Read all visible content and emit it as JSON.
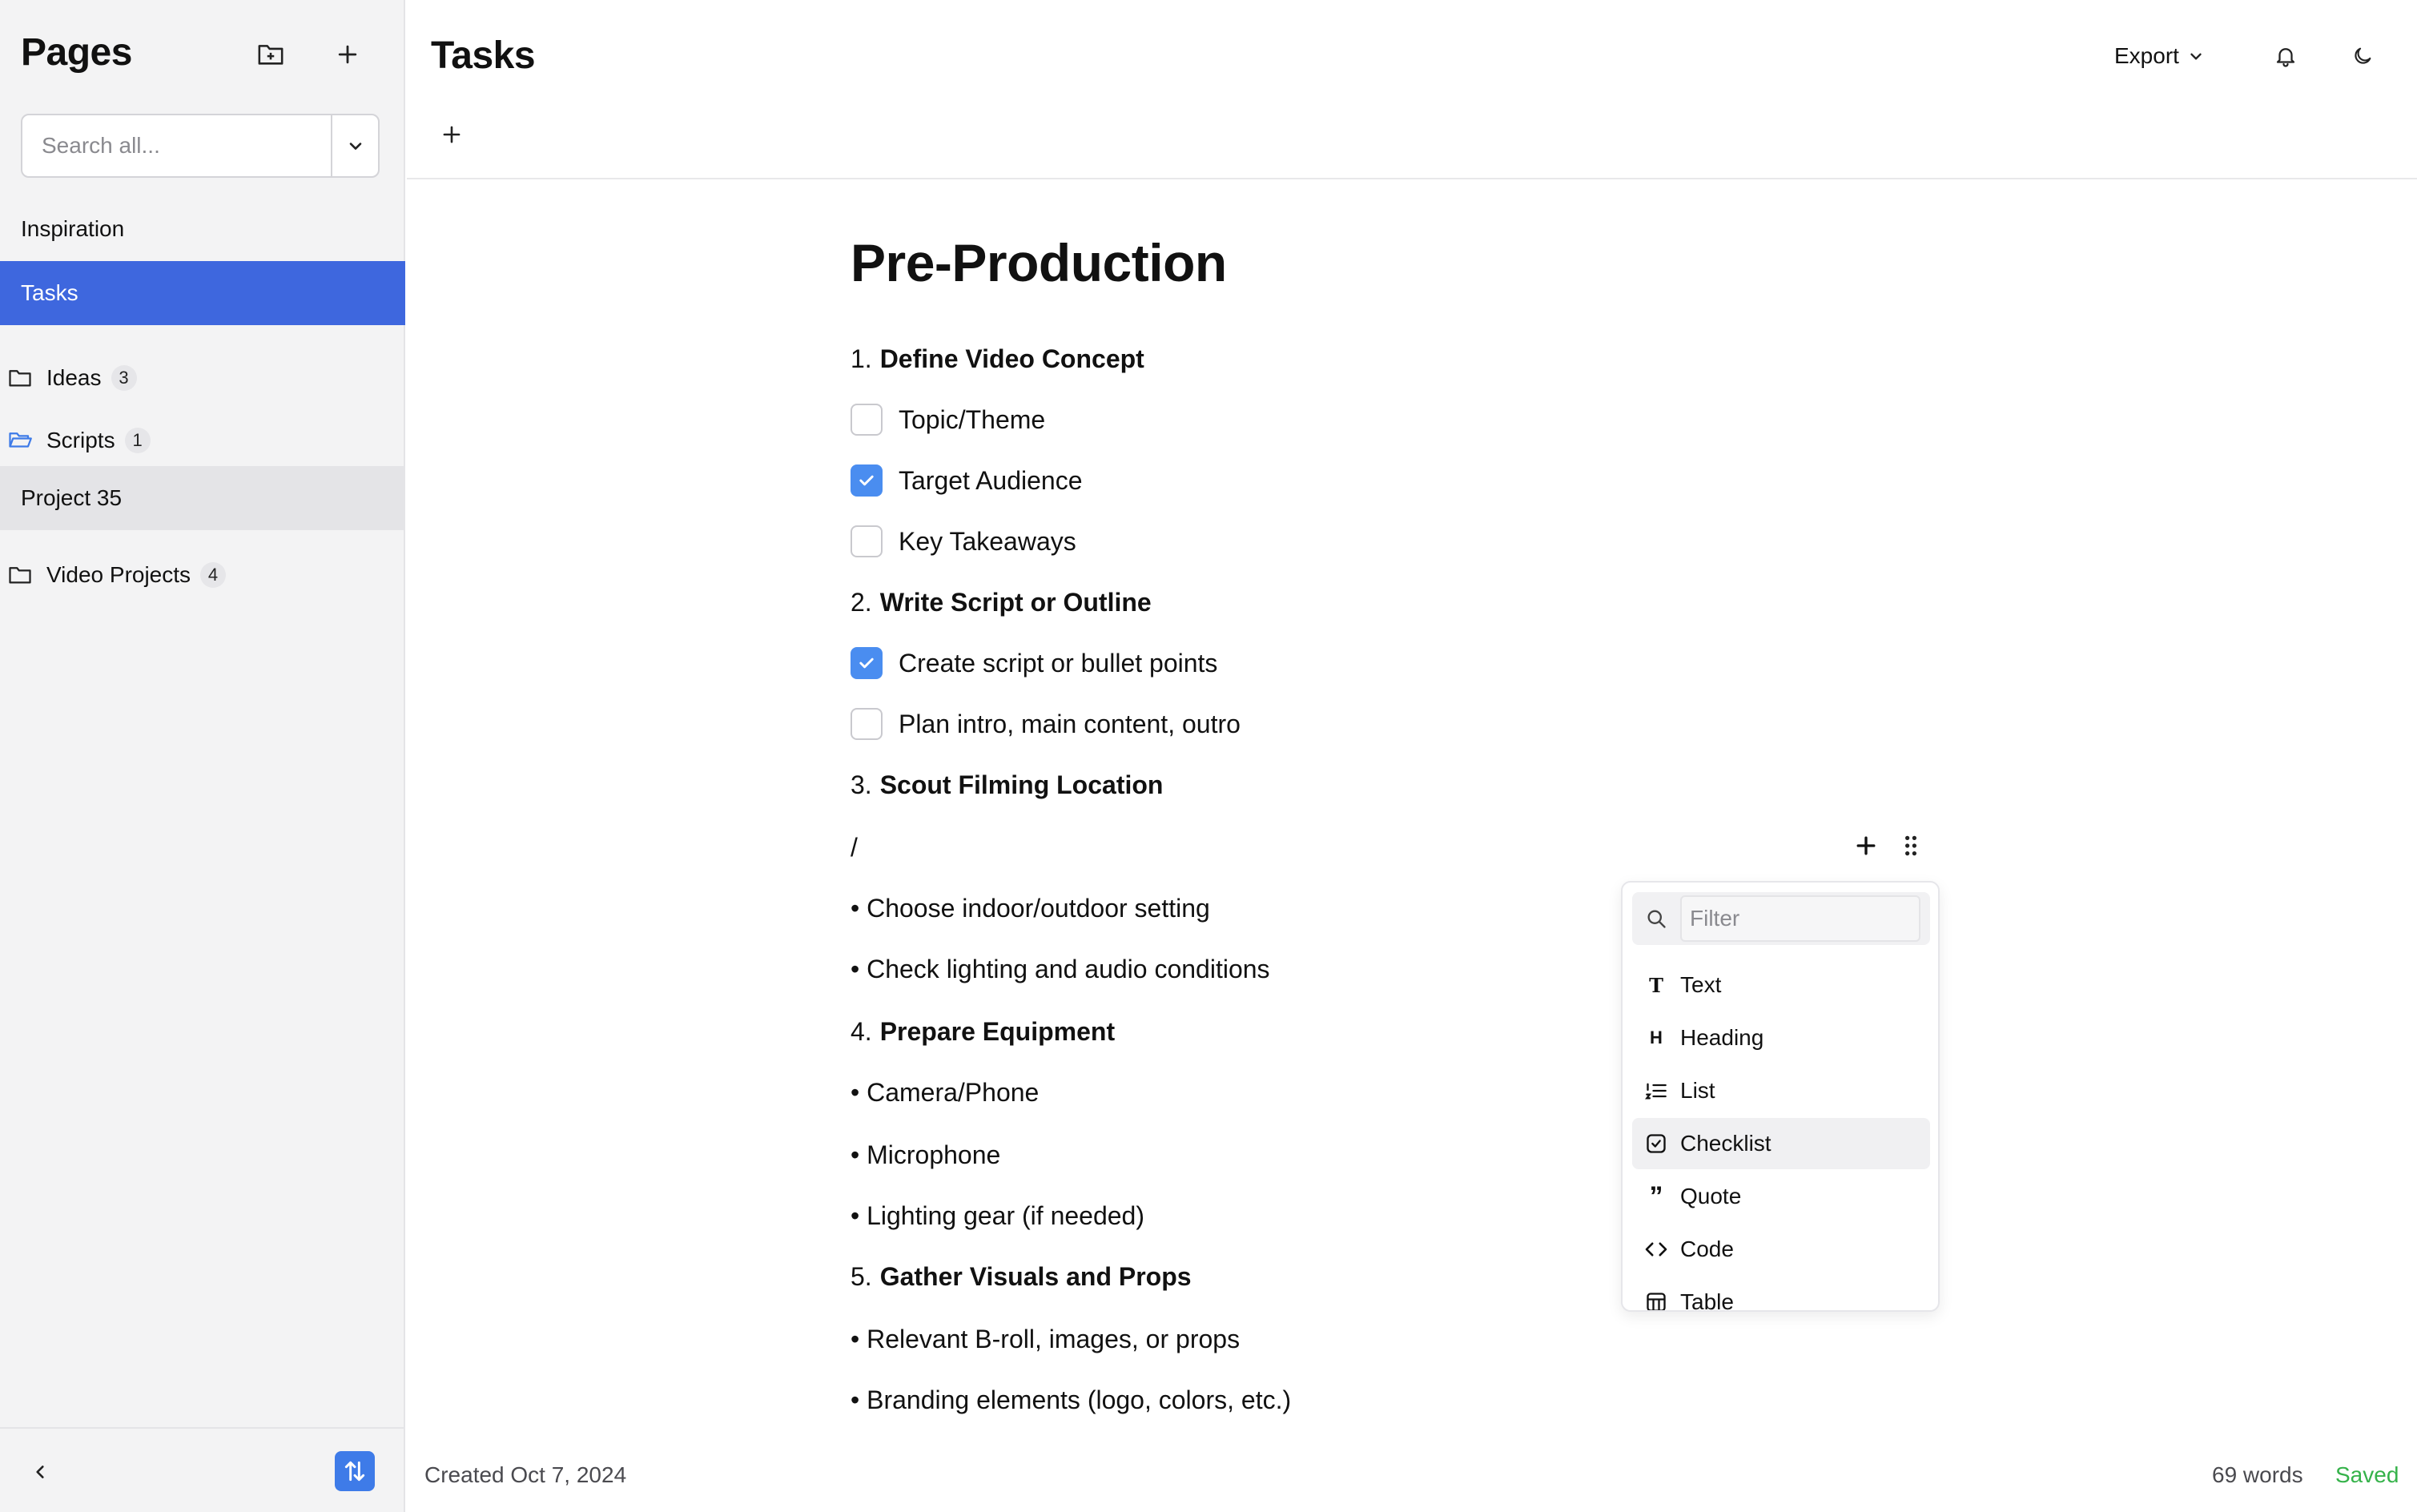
{
  "sidebar": {
    "title": "Pages",
    "search_placeholder": "Search all...",
    "items": [
      {
        "label": "Inspiration"
      },
      {
        "label": "Tasks"
      },
      {
        "label": "Ideas",
        "count": "3"
      },
      {
        "label": "Scripts",
        "count": "1"
      },
      {
        "label": "Project 35"
      },
      {
        "label": "Video Projects",
        "count": "4"
      }
    ]
  },
  "header": {
    "title": "Tasks",
    "export_label": "Export"
  },
  "document": {
    "heading": "Pre-Production",
    "sections": [
      {
        "num": "1.",
        "title": "Define Video Concept"
      },
      {
        "num": "2.",
        "title": "Write Script or Outline"
      },
      {
        "num": "3.",
        "title": "Scout Filming Location"
      },
      {
        "num": "4.",
        "title": "Prepare Equipment"
      },
      {
        "num": "5.",
        "title": "Gather Visuals and Props"
      }
    ],
    "checklist": [
      {
        "text": "Topic/Theme",
        "checked": false
      },
      {
        "text": "Target Audience",
        "checked": true
      },
      {
        "text": "Key Takeaways",
        "checked": false
      },
      {
        "text": "Create script or bullet points",
        "checked": true
      },
      {
        "text": "Plan intro, main content, outro",
        "checked": false
      }
    ],
    "slash_line": "/",
    "bullets": [
      "• Choose indoor/outdoor setting",
      "• Check lighting and audio conditions",
      "• Camera/Phone",
      "• Microphone",
      "• Lighting gear (if needed)",
      "• Relevant B-roll, images, or props",
      "• Branding elements (logo, colors, etc.)"
    ]
  },
  "slash_menu": {
    "filter_placeholder": "Filter",
    "items": [
      {
        "label": "Text",
        "icon": "text-icon",
        "glyph": "T"
      },
      {
        "label": "Heading",
        "icon": "heading-icon",
        "glyph": "H"
      },
      {
        "label": "List",
        "icon": "list-icon"
      },
      {
        "label": "Checklist",
        "icon": "checklist-icon",
        "highlighted": true
      },
      {
        "label": "Quote",
        "icon": "quote-icon",
        "glyph": "”"
      },
      {
        "label": "Code",
        "icon": "code-icon"
      },
      {
        "label": "Table",
        "icon": "table-icon"
      }
    ]
  },
  "footer": {
    "created": "Created Oct 7, 2024",
    "word_count": "69 words",
    "status": "Saved"
  },
  "colors": {
    "accent": "#3e67de",
    "checkbox": "#4a8df0",
    "saved": "#35b24a"
  }
}
